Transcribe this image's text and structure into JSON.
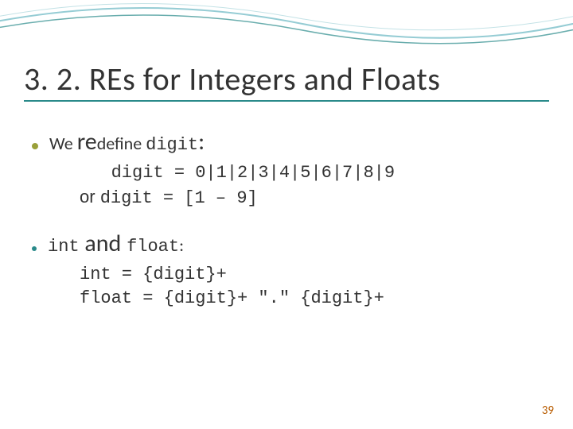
{
  "title": "3. 2. REs for Integers and Floats",
  "bullet1": {
    "we": "We ",
    "re": "re",
    "define": "define ",
    "digit": "digit",
    "colon": ":"
  },
  "code1_line1": "   digit = 0|1|2|3|4|5|6|7|8|9",
  "code1_or": "or ",
  "code1_line2": "digit = [1 – 9]",
  "bullet2": {
    "int": "int",
    "and": " and ",
    "float": "float",
    "colon": ":"
  },
  "code2_line1": "int = {digit}+",
  "code2_line2": "float = {digit}+ \".\" {digit}+",
  "page_number": "39"
}
